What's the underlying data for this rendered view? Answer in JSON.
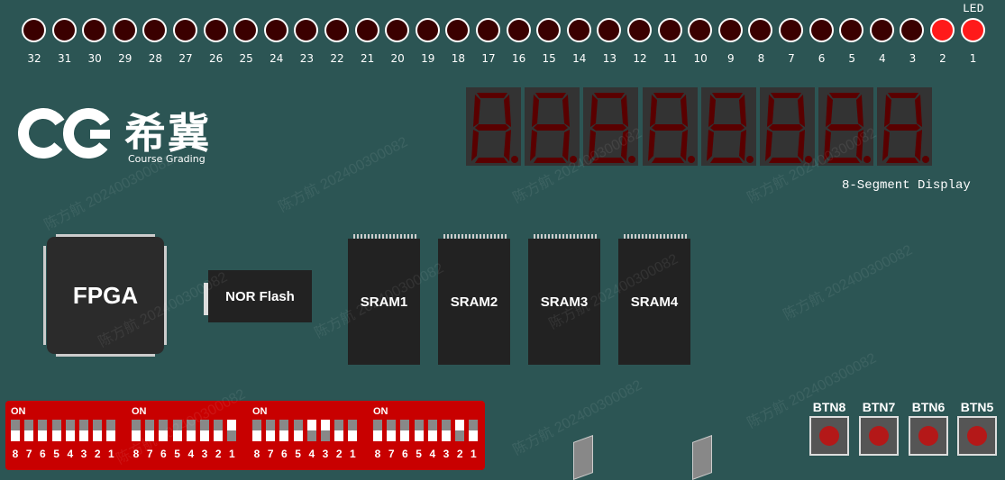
{
  "led": {
    "title": "LED",
    "numbers": [
      "32",
      "31",
      "30",
      "29",
      "28",
      "27",
      "26",
      "25",
      "24",
      "23",
      "22",
      "21",
      "20",
      "19",
      "18",
      "17",
      "16",
      "15",
      "14",
      "13",
      "12",
      "11",
      "10",
      "9",
      "8",
      "7",
      "6",
      "5",
      "4",
      "3",
      "2",
      "1"
    ],
    "on": [
      false,
      false,
      false,
      false,
      false,
      false,
      false,
      false,
      false,
      false,
      false,
      false,
      false,
      false,
      false,
      false,
      false,
      false,
      false,
      false,
      false,
      false,
      false,
      false,
      false,
      false,
      false,
      false,
      false,
      false,
      true,
      true
    ],
    "on_color": "#ff1a1a",
    "off_color": "#3a0000"
  },
  "logo": {
    "mark": "CG",
    "brand": "希冀",
    "subtitle": "Course Grading"
  },
  "seven_segment": {
    "title": "8-Segment Display",
    "digit_count": 8,
    "segment_color": "#5a0000"
  },
  "chips": {
    "fpga": "FPGA",
    "nor": "NOR Flash",
    "sram": [
      "SRAM1",
      "SRAM2",
      "SRAM3",
      "SRAM4"
    ]
  },
  "dip": {
    "on_label": "ON",
    "numbers": [
      "8",
      "7",
      "6",
      "5",
      "4",
      "3",
      "2",
      "1"
    ],
    "banks": [
      [
        false,
        false,
        false,
        false,
        false,
        false,
        false,
        false
      ],
      [
        false,
        false,
        false,
        false,
        false,
        false,
        false,
        true
      ],
      [
        false,
        false,
        false,
        false,
        true,
        true,
        false,
        false
      ],
      [
        false,
        false,
        false,
        false,
        false,
        false,
        true,
        false
      ]
    ]
  },
  "buttons": [
    "BTN8",
    "BTN7",
    "BTN6",
    "BTN5"
  ],
  "watermark": "陈方航 202400300082",
  "colors": {
    "background": "#2c5554",
    "dip": "#c80000",
    "button_cap": "#b41818"
  }
}
